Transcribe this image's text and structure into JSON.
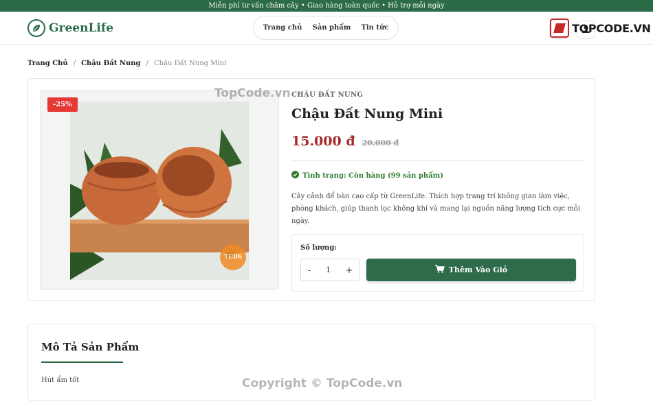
{
  "topbar": {
    "text": "Miễn phí tư vấn chăm cây • Giao hàng toàn quốc • Hỗ trợ mỗi ngày"
  },
  "header": {
    "logo_text": "GreenLife",
    "nav": [
      "Trang chủ",
      "Sản phẩm",
      "Tin tức"
    ],
    "icons": [
      "cart-icon",
      "user-icon"
    ]
  },
  "watermarks": {
    "logo_text": "TOPCODE.VN",
    "image_text": "TopCode.vn",
    "copyright": "Copyright © TopCode.vn"
  },
  "breadcrumb": {
    "items": [
      "Trang Chủ",
      "Chậu Đất Nung",
      "Chậu Đất Nung Mini"
    ],
    "separator": "/"
  },
  "product": {
    "discount_badge": "-25%",
    "category": "CHẬU ĐẤT NUNG",
    "name": "Chậu Đất Nung Mini",
    "price": "15.000 đ",
    "old_price": "20.000 đ",
    "stock": "Tình trạng: Còn hàng (99 sản phẩm)",
    "description": "Cây cảnh để bàn cao cấp từ GreenLife. Thích hợp trang trí không gian làm việc, phòng khách, giúp thanh lọc không khí và mang lại nguồn năng lượng tích cực mỗi ngày.",
    "quantity_label": "Số lượng:",
    "quantity": "1",
    "minus": "-",
    "plus": "+",
    "add_to_cart": "Thêm Vào Giỏ",
    "image_badge": "TC06"
  },
  "description_section": {
    "title": "Mô Tả Sản Phẩm",
    "body": "Hút ẩm tốt"
  },
  "colors": {
    "brand_green": "#2c6b47",
    "price_red": "#a52a2a",
    "discount_red": "#e53935",
    "stock_green": "#2e7d32"
  }
}
